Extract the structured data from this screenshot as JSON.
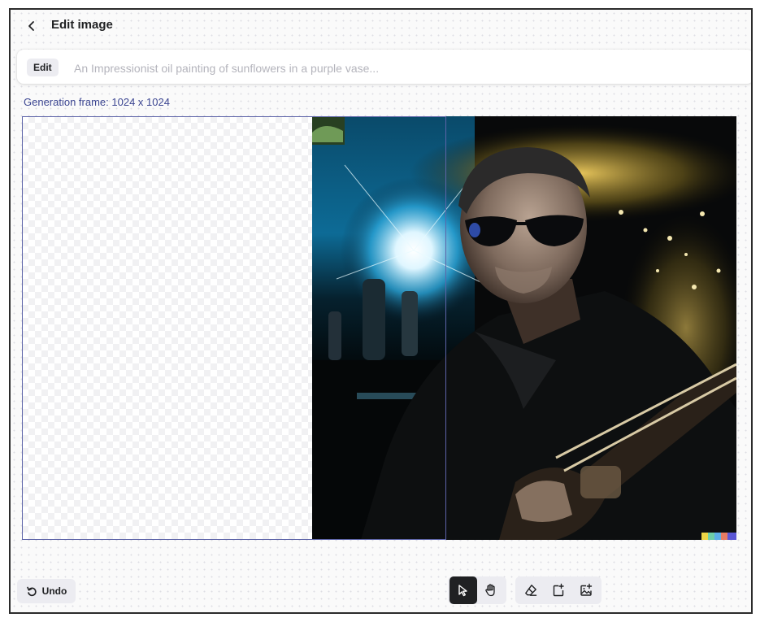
{
  "header": {
    "back_icon": "chevron-left-icon",
    "title": "Edit image"
  },
  "prompt": {
    "badge": "Edit",
    "value": "",
    "placeholder": "An Impressionist oil painting of sunflowers in a purple vase..."
  },
  "canvas": {
    "frame_label": "Generation frame: 1024 x 1024",
    "frame_color": "#5d64a8",
    "image_description_visible": "photo-generated-man-with-sunglasses"
  },
  "toolbar": {
    "undo_label": "Undo",
    "undo_icon": "undo-icon",
    "navigation_tools": [
      {
        "name": "select",
        "icon": "cursor-arrow-icon",
        "active": true
      },
      {
        "name": "pan",
        "icon": "hand-icon",
        "active": false
      }
    ],
    "edit_tools": [
      {
        "name": "eraser",
        "icon": "eraser-icon",
        "active": false
      },
      {
        "name": "add-generation-frame",
        "icon": "add-frame-icon",
        "active": false
      },
      {
        "name": "upload-image",
        "icon": "image-add-icon",
        "active": false
      }
    ]
  },
  "colors": {
    "accent_text": "#3b4591",
    "active_tool_bg": "#202123",
    "button_bg": "#ececf1"
  }
}
